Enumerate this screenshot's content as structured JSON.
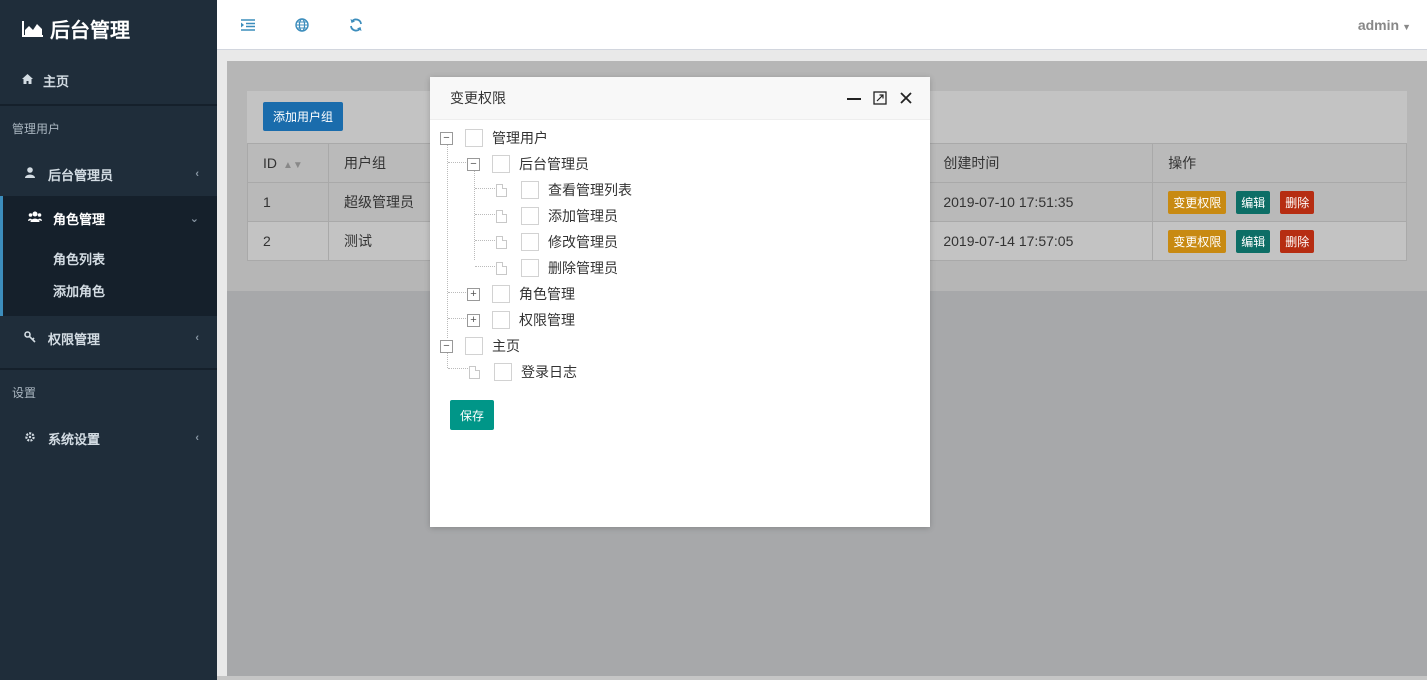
{
  "brand": {
    "title": "后台管理",
    "icon": "chart-area-icon"
  },
  "sidebar": {
    "home": "主页",
    "section_users": "管理用户",
    "items": [
      {
        "label": "后台管理员",
        "icon": "user-icon"
      },
      {
        "label": "角色管理",
        "icon": "users-icon"
      },
      {
        "label": "权限管理",
        "icon": "key-icon"
      }
    ],
    "sub_items": [
      "角色列表",
      "添加角色"
    ],
    "section_settings": "设置",
    "settings_item": {
      "label": "系统设置",
      "icon": "gear-icon"
    }
  },
  "topbar": {
    "tools": [
      "menu-toggle-icon",
      "globe-icon",
      "refresh-icon"
    ],
    "user": "admin"
  },
  "main": {
    "add_button": "添加用户组",
    "table": {
      "headers": [
        "ID",
        "用户组",
        "创建时间",
        "操作"
      ],
      "rows": [
        {
          "id": "1",
          "group": "超级管理员",
          "created": "2019-07-10 17:51:35"
        },
        {
          "id": "2",
          "group": "测试",
          "created": "2019-07-14 17:57:05"
        }
      ],
      "actions": [
        "变更权限",
        "编辑",
        "删除"
      ]
    }
  },
  "modal": {
    "title": "变更权限",
    "tree": [
      {
        "label": "管理用户",
        "level": 0,
        "type": "expanded",
        "checked": false
      },
      {
        "label": "后台管理员",
        "level": 1,
        "type": "expanded",
        "checked": false
      },
      {
        "label": "查看管理列表",
        "level": 2,
        "type": "leaf",
        "checked": false
      },
      {
        "label": "添加管理员",
        "level": 2,
        "type": "leaf",
        "checked": false
      },
      {
        "label": "修改管理员",
        "level": 2,
        "type": "leaf",
        "checked": false
      },
      {
        "label": "删除管理员",
        "level": 2,
        "type": "leaf",
        "checked": false
      },
      {
        "label": "角色管理",
        "level": 1,
        "type": "collapsed",
        "checked": false
      },
      {
        "label": "权限管理",
        "level": 1,
        "type": "collapsed",
        "checked": false
      },
      {
        "label": "主页",
        "level": 0,
        "type": "expanded",
        "checked": false
      },
      {
        "label": "登录日志",
        "level": 1,
        "type": "leaf",
        "checked": false
      }
    ],
    "save": "保存"
  },
  "colors": {
    "sidebar_bg": "#1f2d3a",
    "primary": "#1a6cac",
    "save": "#009688",
    "warn": "#c88a12",
    "edit": "#0d6e66",
    "danger": "#b62d12"
  }
}
